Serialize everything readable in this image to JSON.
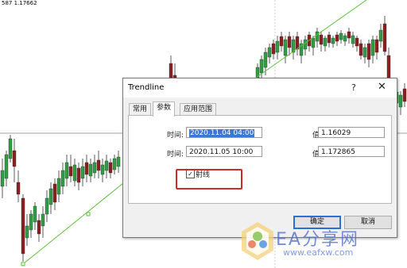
{
  "chart": {
    "price_header": "587 1.17662",
    "colors": {
      "bull": "#2f9e44",
      "bear": "#8b1e1e",
      "trendline": "#5cc03a",
      "hline": "#a0a0a0",
      "vline": "#d0d0d0"
    }
  },
  "dialog": {
    "title": "Trendline",
    "help_label": "?",
    "close_label": "✕",
    "tabs": [
      {
        "label": "常用",
        "active": false
      },
      {
        "label": "参数",
        "active": true
      },
      {
        "label": "应用范围",
        "active": false
      }
    ],
    "rows": [
      {
        "time_label": "时间:",
        "time_value": "2020.11.04 04:00",
        "value_label": "值:",
        "value": "1.16029"
      },
      {
        "time_label": "时间:",
        "time_value": "2020.11.05 10:00",
        "value_label": "值:",
        "value": "1.172865"
      }
    ],
    "ray": {
      "label": "射线",
      "checked": true,
      "check_mark": "✓"
    },
    "ok_label": "确定",
    "cancel_label": "取消"
  },
  "watermark": {
    "text": "EA分享网",
    "url": "www.eafxw.com"
  }
}
